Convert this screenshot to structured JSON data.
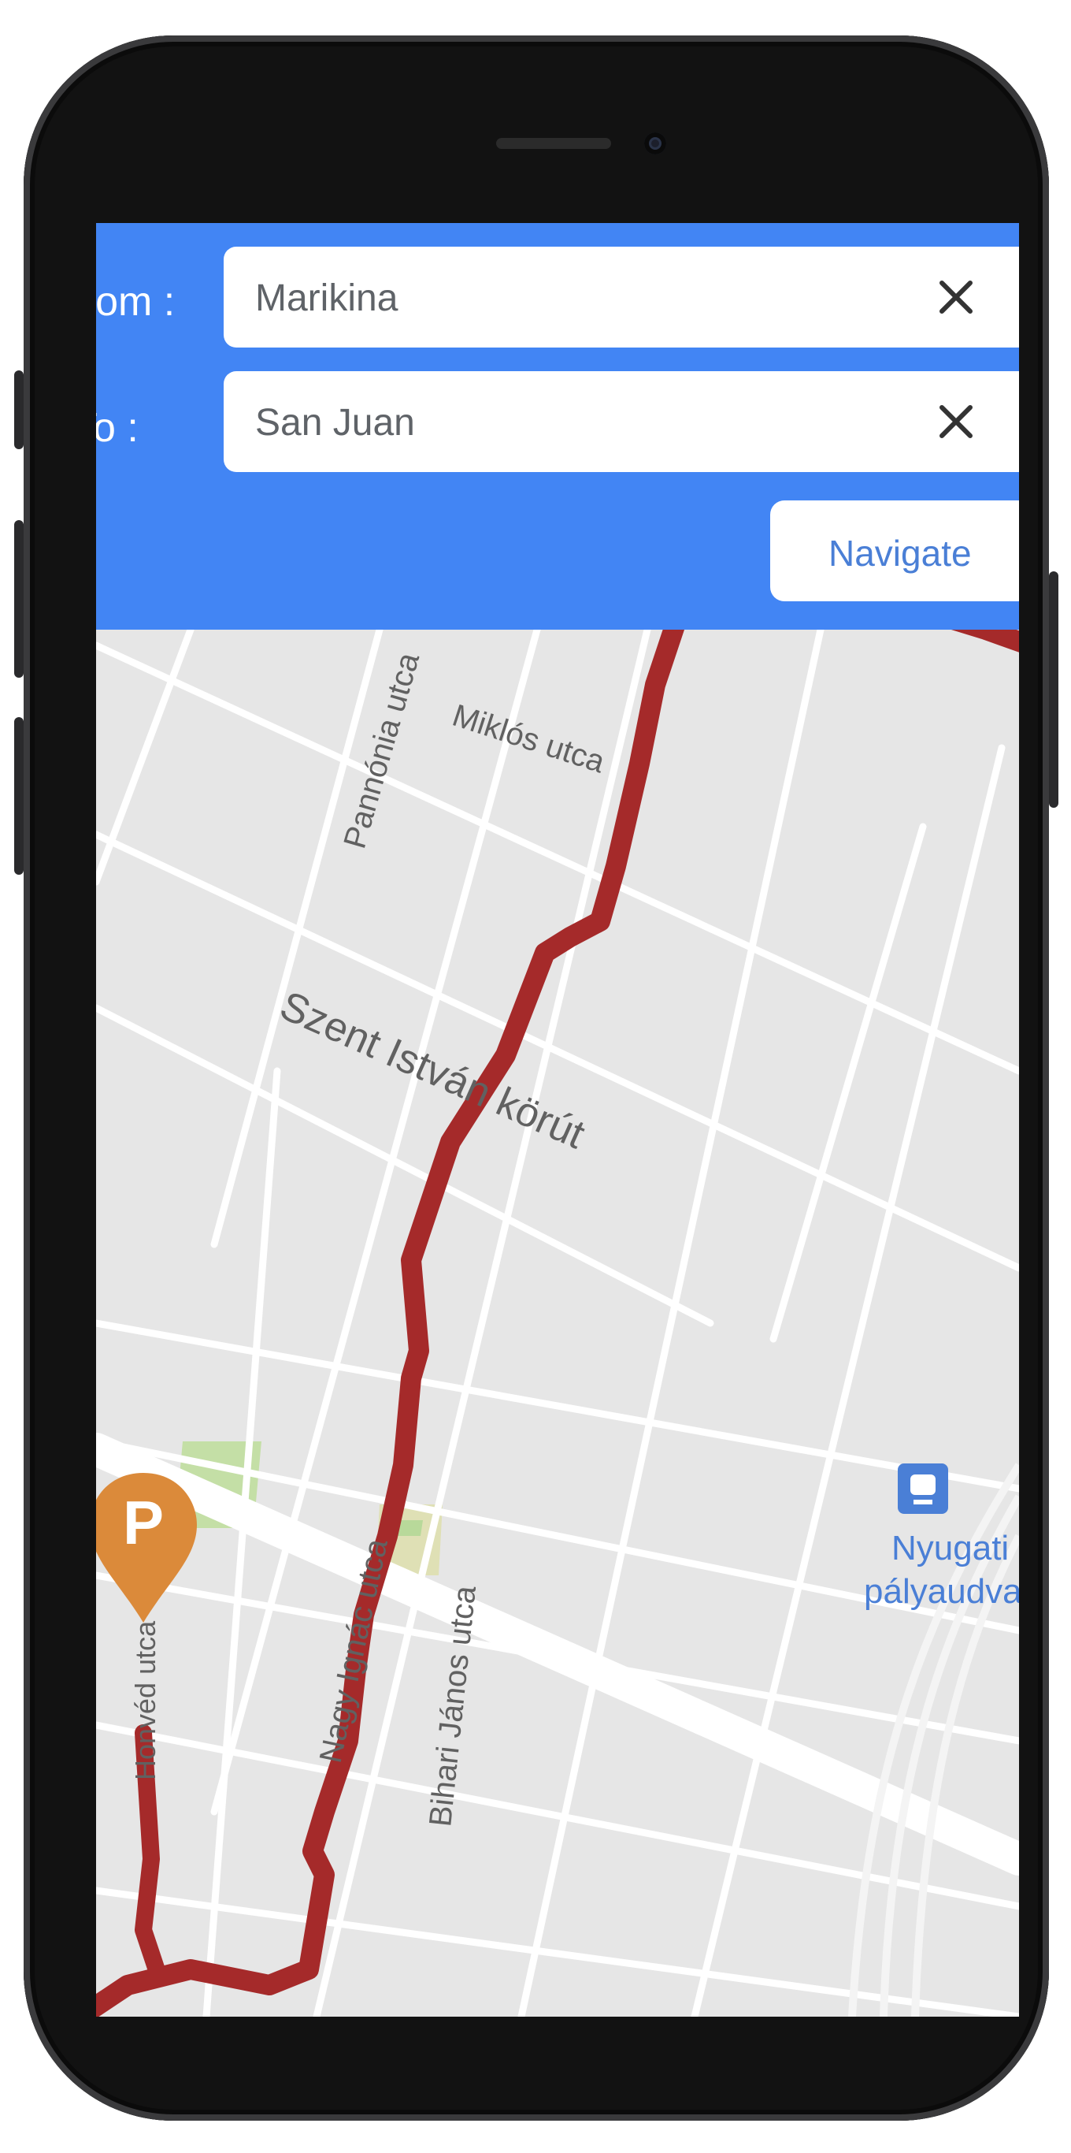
{
  "route_form": {
    "from_label": "From :",
    "from_value": "Marikina",
    "to_label": "To :",
    "to_value": "San Juan",
    "navigate_label": "Navigate"
  },
  "map": {
    "streets": {
      "pannonia": "Pannónia utca",
      "szent_istvan": "Szent István körút",
      "nagy_ignac": "Nagy Ignác utca",
      "bihari": "Bihari János utca",
      "miklos": "Miklós utca",
      "honved": "Honvéd utca"
    },
    "poi": {
      "name_line1": "Nyugati",
      "name_line2": "pályaudvar"
    },
    "parking_marker": "P"
  },
  "colors": {
    "header": "#4285f4",
    "route": "#a52a2a",
    "parking": "#db8a3a",
    "park": "#c4dfa6",
    "transit": "#4a7fd6"
  },
  "icons": [
    "close-icon",
    "parking-marker-icon",
    "train-station-icon"
  ]
}
